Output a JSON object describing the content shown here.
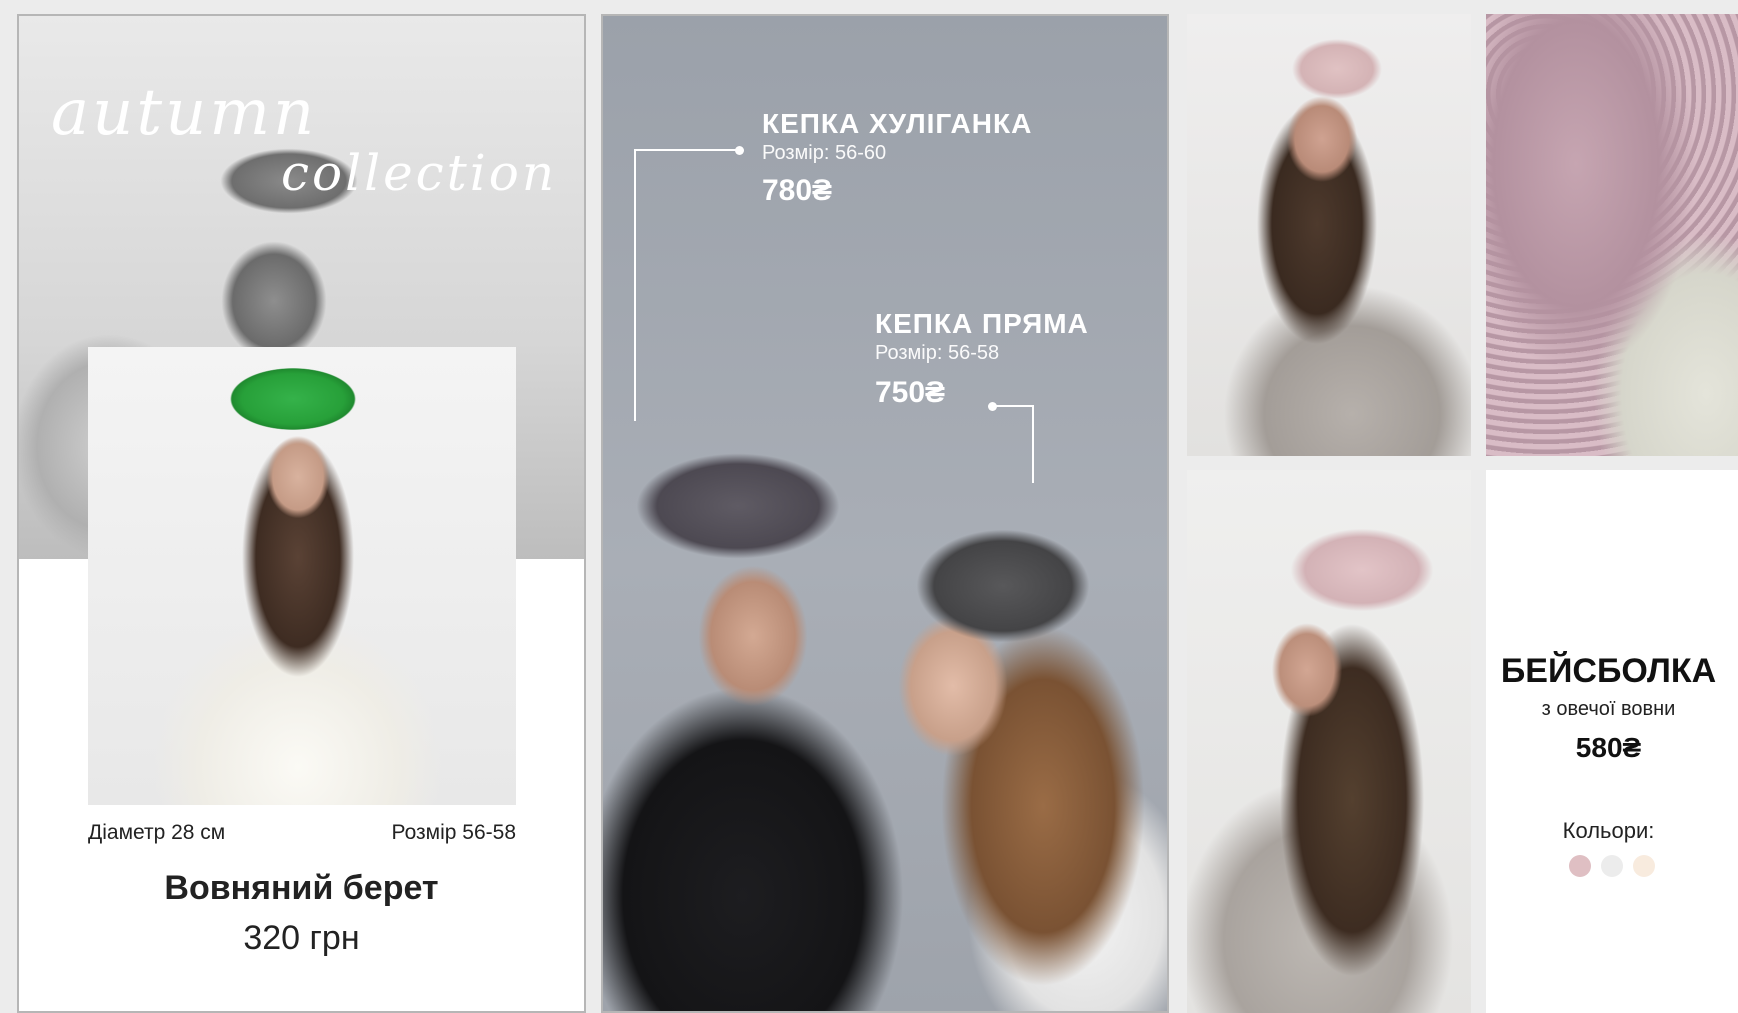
{
  "panel1": {
    "script_line1": "autumn",
    "script_line2": "collection",
    "diameter": "Діаметр 28 см",
    "size": "Розмір 56-58",
    "name": "Вовняний берет",
    "price": "320 грн",
    "colors": {
      "background_bw": "#d6d6d6",
      "beret": "#27a039"
    }
  },
  "panel2": {
    "product1": {
      "title": "КЕПКА ХУЛІГАНКА",
      "size": "Розмір: 56-60",
      "price": "780₴"
    },
    "product2": {
      "title": "КЕПКА ПРЯМА",
      "size": "Розмір: 56-58",
      "price": "750₴"
    },
    "colors": {
      "background": "#a4a9b1",
      "text": "#ffffff"
    }
  },
  "panel3": {
    "title": "БЕЙСБОЛКА",
    "subtitle": "з овечої вовни",
    "price": "580₴",
    "colors_label": "Кольори:",
    "swatches": [
      {
        "name": "pink",
        "color": "#dfbfc3"
      },
      {
        "name": "light-gray",
        "color": "#ececec"
      },
      {
        "name": "cream",
        "color": "#f8ebde"
      }
    ]
  }
}
